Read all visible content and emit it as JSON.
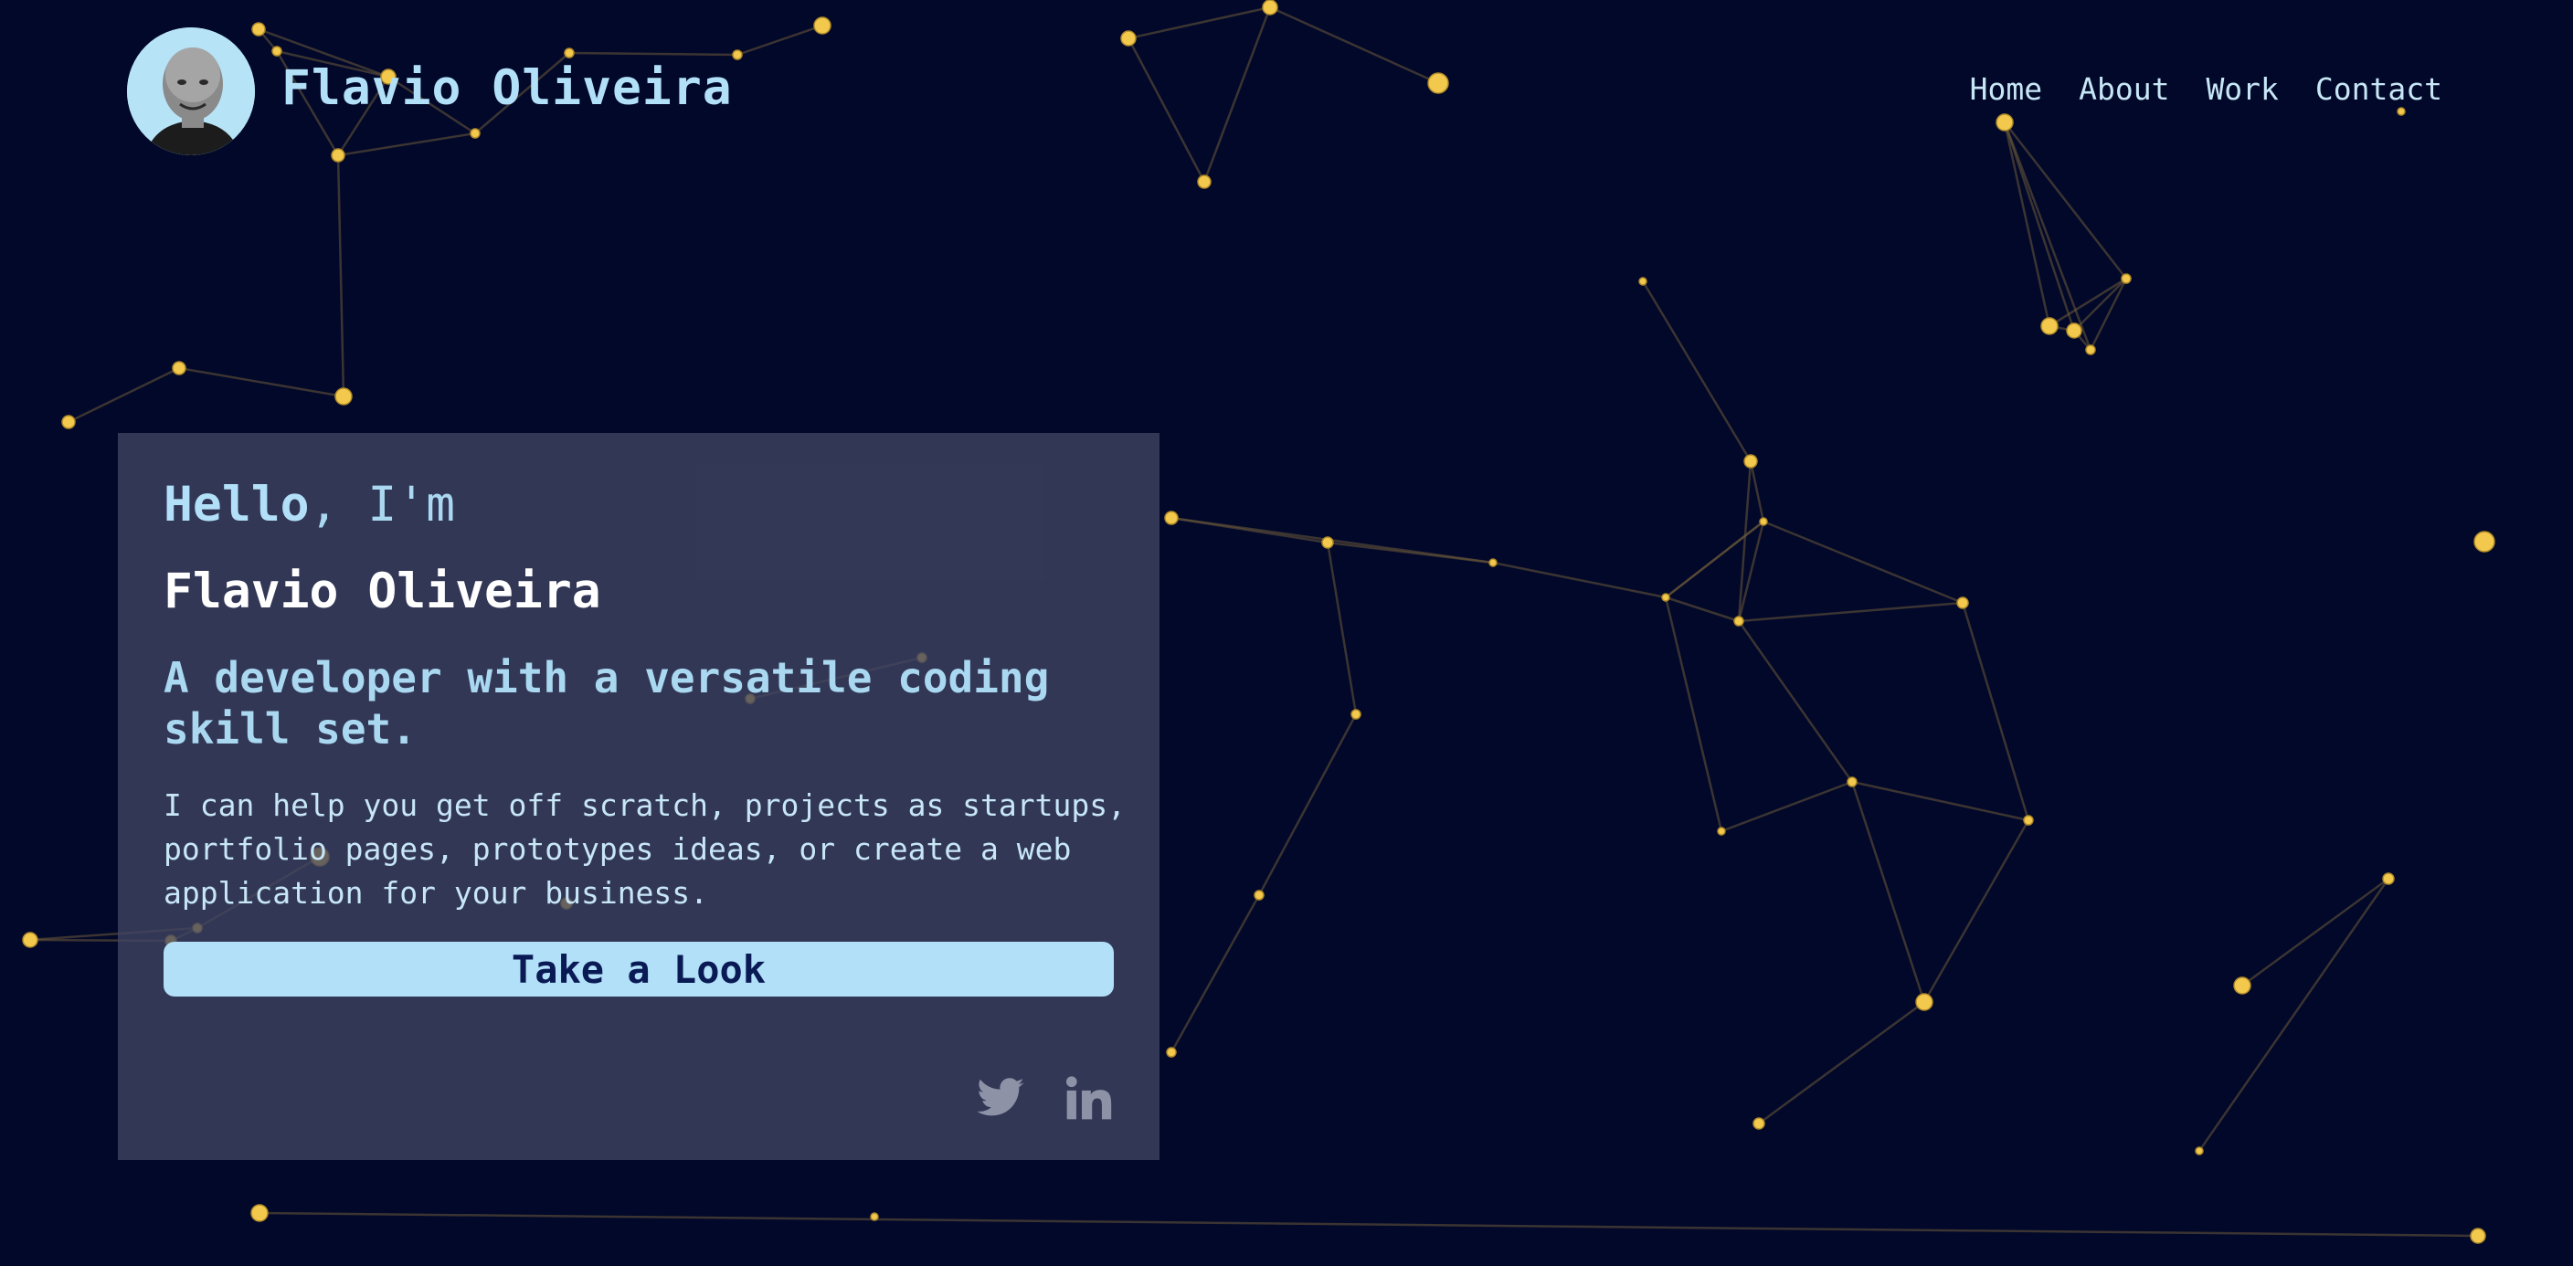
{
  "header": {
    "brand": "Flavio Oliveira",
    "nav": [
      {
        "label": "Home"
      },
      {
        "label": "About"
      },
      {
        "label": "Work"
      },
      {
        "label": "Contact"
      }
    ]
  },
  "hero": {
    "greeting_bold": "Hello",
    "greeting_rest": ", I'm",
    "name": "Flavio Oliveira",
    "tagline": "A developer with a versatile coding skill set.",
    "description": "I can help you get off scratch, projects as startups, portfolio pages, prototypes ideas, or create a web application for your business.",
    "cta_label": "Take a Look"
  },
  "social": {
    "icons": [
      "twitter-icon",
      "linkedin-icon"
    ]
  },
  "colors": {
    "background": "#010829",
    "card": "#404563",
    "accent": "#b2e0f8",
    "node": "#f2c94c"
  }
}
